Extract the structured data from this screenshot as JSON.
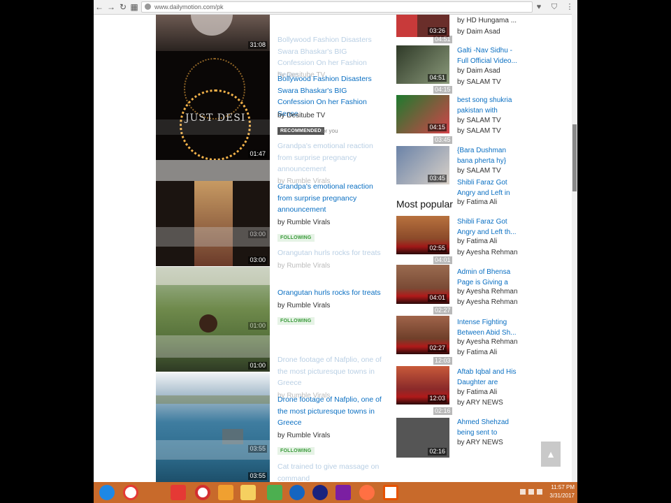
{
  "browser": {
    "url": "www.dailymotion.com/pk",
    "back_glyph": "←",
    "forward_glyph": "→",
    "reload_glyph": "↻",
    "apps_glyph": "▦",
    "bookmark_glyph": "♥",
    "shield_glyph": "⛉",
    "menu_glyph": "⋮"
  },
  "left_feed": {
    "items": [
      {
        "duration": "31:08"
      },
      {
        "ghost_title": "Bollywood Fashion Disasters Swara Bhaskar's BIG Confession On her Fashion Sense",
        "ghost_owner": "by Desitube TV",
        "title": "Bollywood Fashion Disasters Swara Bhaskar's BIG Confession On her Fashion Sense",
        "owner": "by Desitube TV",
        "duration": "01:47",
        "badge": "RECOMMENDED",
        "badge_suffix": "for you",
        "thumb_text": "JUST DESI"
      },
      {
        "ghost_title": "Grandpa's emotional reaction from surprise pregnancy announcement",
        "ghost_owner": "by Rumble Virals",
        "title": "Grandpa's emotional reaction from surprise pregnancy announcement",
        "owner": "by Rumble Virals",
        "duration": "03:00",
        "ghost_duration": "03:00",
        "badge": "FOLLOWING"
      },
      {
        "ghost_title": "Orangutan hurls rocks for treats",
        "ghost_owner": "by Rumble Virals",
        "title": "Orangutan hurls rocks for treats",
        "owner": "by Rumble Virals",
        "duration": "01:00",
        "ghost_duration": "01:00",
        "badge": "FOLLOWING"
      },
      {
        "ghost_title": "Drone footage of Nafplio, one of the most picturesque towns in Greece",
        "ghost_owner": "by Rumble Virals",
        "title": "Drone footage of Nafplio, one of the most picturesque towns in Greece",
        "owner": "by Rumble Virals",
        "duration": "03:55",
        "ghost_duration": "03:55",
        "badge": "FOLLOWING"
      },
      {
        "ghost_title": "Cat trained to give massage on command"
      }
    ]
  },
  "right_feed": {
    "section_heading": "Most popular",
    "items": [
      {
        "title": "",
        "owner": "by HD Hungama ...",
        "ghost_owner": "by Daim Asad",
        "duration": "03:26",
        "ghost_duration": "04:51"
      },
      {
        "title": "Galti -Nav Sidhu - Full Official Video...",
        "owner": "by Daim Asad",
        "ghost_owner": "by SALAM TV",
        "duration": "04:51",
        "ghost_duration": "04:15"
      },
      {
        "title": "best song shukria pakistan with",
        "owner": "by SALAM TV",
        "ghost_owner": "by SALAM TV",
        "duration": "04:15",
        "ghost_duration": "03:45"
      },
      {
        "title": "{Bara Dushman bana pherta hy}",
        "owner": "by SALAM TV",
        "ghost_title": "Shibli Faraz Got Angry and Left in",
        "ghost_owner": "by Fatima Ali",
        "duration": "03:45"
      },
      {
        "title": "Shibli Faraz Got Angry and Left th...",
        "owner": "by Fatima Ali",
        "ghost_owner": "by Ayesha Rehman",
        "duration": "02:55",
        "ghost_duration": "04:01"
      },
      {
        "title": "Admin of Bhensa Page is Giving a",
        "owner": "by Ayesha Rehman",
        "ghost_owner": "by Ayesha Rehman",
        "duration": "04:01",
        "ghost_duration": "02:27"
      },
      {
        "title": "Intense Fighting Between Abid Sh...",
        "owner": "by Ayesha Rehman",
        "ghost_owner": "by Fatima Ali",
        "duration": "02:27",
        "ghost_duration": "12:03"
      },
      {
        "title": "Aftab Iqbal and His Daughter are",
        "owner": "by Fatima Ali",
        "ghost_owner": "by ARY NEWS",
        "duration": "12:03",
        "ghost_duration": "02:16"
      },
      {
        "title": "Ahmed Shehzad being sent to",
        "owner": "by ARY NEWS",
        "duration": "02:16"
      }
    ]
  },
  "to_top_glyph": "▲",
  "taskbar": {
    "clock_time": "11:57 PM",
    "clock_date": "3/31/2017",
    "icons": [
      "ie-icon",
      "app-circle-icon",
      "download-icon",
      "opera-icon",
      "winamp-icon",
      "media-player-icon",
      "paint-icon",
      "help-icon",
      "app-dark-icon",
      "winrar-icon",
      "firefox-icon",
      "camtasia-icon"
    ]
  },
  "colors": {
    "accent_link": "#0a6fc2",
    "taskbar": "#c86a2b"
  }
}
